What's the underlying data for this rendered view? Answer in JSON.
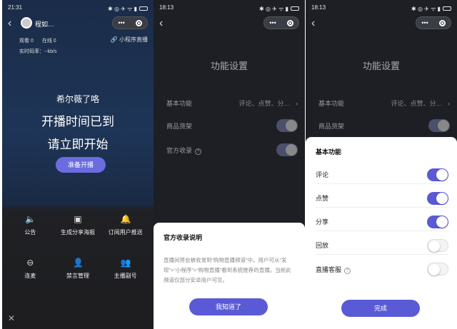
{
  "phone1": {
    "status_time": "21:31",
    "room_name": "程如…",
    "mini_program": "小程序直播",
    "viewers": "观看 0",
    "online": "在线 0",
    "bitrate": "实时码率：--kb/s",
    "anchor_name": "希尔薇了咯",
    "line1": "开播时间已到",
    "line2": "请立即开始",
    "start_button": "准备开播",
    "menu": [
      {
        "label": "公告",
        "icon": "🔈"
      },
      {
        "label": "生成分享海报",
        "icon": "▣"
      },
      {
        "label": "订阅用户推送",
        "icon": "🔔"
      },
      {
        "label": "连麦",
        "icon": "⊖"
      },
      {
        "label": "禁言管理",
        "icon": "👤"
      },
      {
        "label": "主播副号",
        "icon": "👥"
      }
    ]
  },
  "phone2": {
    "status_time": "18:13",
    "title": "功能设置",
    "basic": "基本功能",
    "basic_value": "评论、点赞、分…",
    "goods": "商品货架",
    "official": "官方收录",
    "dialog_title": "官方收录说明",
    "dialog_text": "直播间将会被收录到“购物直播频道”中。用户可从“发现”>“小程序”>“购物直播”看到系统推荐的直播。当前此频道仅部分安卓用户可见。",
    "ok_button": "我知道了"
  },
  "phone3": {
    "status_time": "18:13",
    "title": "功能设置",
    "basic": "基本功能",
    "basic_value": "评论、点赞、分…",
    "goods": "商品货架",
    "sheet_title": "基本功能",
    "rows": [
      {
        "label": "评论",
        "on": true
      },
      {
        "label": "点赞",
        "on": true
      },
      {
        "label": "分享",
        "on": true
      },
      {
        "label": "回放",
        "on": false
      },
      {
        "label": "直播客服",
        "on": false
      }
    ],
    "done_button": "完成"
  },
  "colors": {
    "accent": "#5a5ad6",
    "dark_bg": "#1d1f24"
  }
}
